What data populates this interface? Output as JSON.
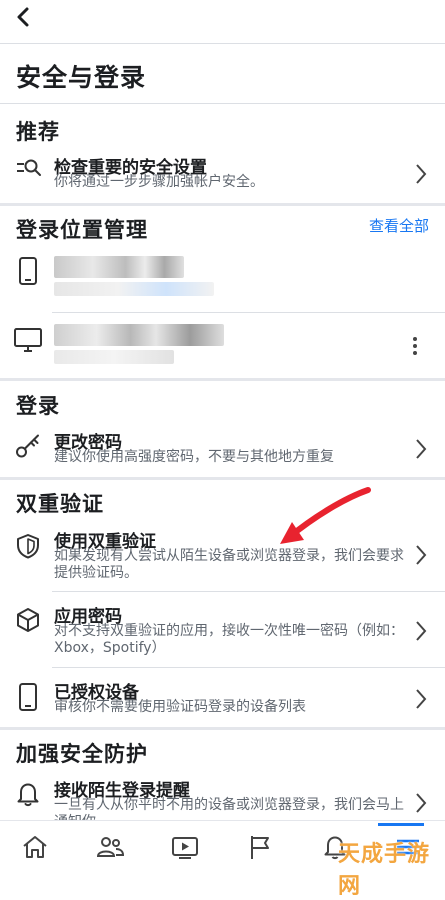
{
  "header": {
    "title": "安全与登录"
  },
  "recommend": {
    "title": "推荐",
    "item": {
      "title": "检查重要的安全设置",
      "desc": "你将通过一步步骤加强帐户安全。"
    }
  },
  "login_locations": {
    "title": "登录位置管理",
    "see_all": "查看全部"
  },
  "login": {
    "title": "登录",
    "item": {
      "title": "更改密码",
      "desc": "建议你使用高强度密码，不要与其他地方重复"
    }
  },
  "two_factor": {
    "title": "双重验证",
    "items": [
      {
        "title": "使用双重验证",
        "desc": "如果发现有人尝试从陌生设备或浏览器登录，我们会要求提供验证码。"
      },
      {
        "title": "应用密码",
        "desc": "对不支持双重验证的应用，接收一次性唯一密码（例如：Xbox，Spotify）"
      },
      {
        "title": "已授权设备",
        "desc": "审核你不需要使用验证码登录的设备列表"
      }
    ]
  },
  "extra_security": {
    "title": "加强安全防护",
    "item": {
      "title": "接收陌生登录提醒",
      "desc": "一旦有人从你平时不用的设备或浏览器登录，我们会马上通知你"
    }
  },
  "tabs": [
    "home",
    "friends",
    "watch",
    "pages",
    "notifications",
    "menu"
  ],
  "watermark": "天成手游网",
  "colors": {
    "accent": "#1877f2",
    "arrow": "#e8232f",
    "watermark": "#f3a640"
  }
}
